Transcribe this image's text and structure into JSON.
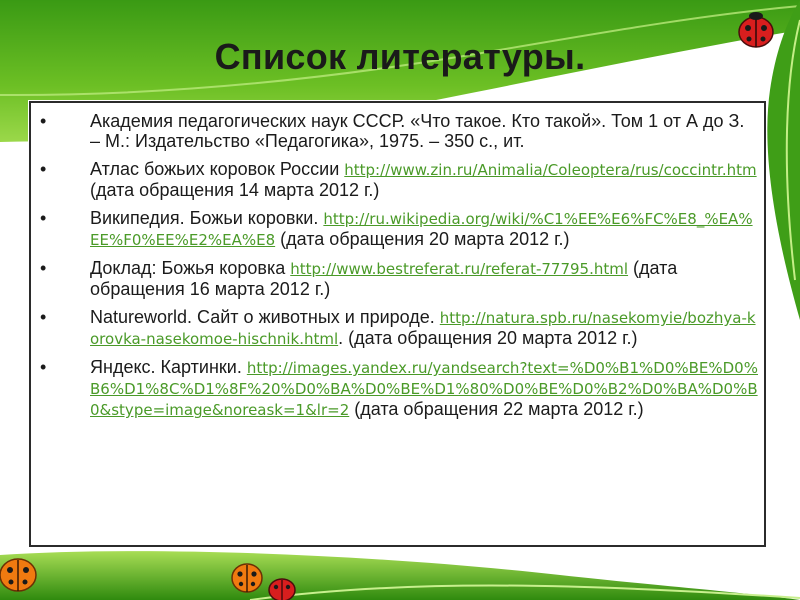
{
  "slide": {
    "title": "Список литературы.",
    "references": [
      {
        "text": "Академия педагогических наук СССР. «Что такое. Кто такой». Том 1 от А до З. – М.: Издательство «Педагогика», 1975. – 350 с., ит.",
        "link": "",
        "after": ""
      },
      {
        "text": "Атлас божьих коровок России ",
        "link": "http://www.zin.ru/Animalia/Coleoptera/rus/coccintr.htm",
        "after": "  (дата обращения 14 марта 2012 г.)"
      },
      {
        "text": "Википедия. Божьи коровки. ",
        "link": "http://ru.wikipedia.org/wiki/%C1%EE%E6%FC%E8_%EA%EE%F0%EE%E2%EA%E8",
        "after": " (дата обращения 20 марта 2012 г.)"
      },
      {
        "text": "Доклад: Божья коровка ",
        "link": "http://www.bestreferat.ru/referat-77795.html",
        "after": " (дата обращения 16 марта 2012 г.)"
      },
      {
        "text": "Natureworld. Сайт о животных и природе. ",
        "link": "http://natura.spb.ru/nasekomyie/bozhya-korovka-nasekomoe-hischnik.html",
        "after": ". (дата обращения 20 марта 2012 г.)"
      },
      {
        "text": "Яндекс. Картинки. ",
        "link": "http://images.yandex.ru/yandsearch?text=%D0%B1%D0%BE%D0%B6%D1%8C%D1%8F%20%D0%BA%D0%BE%D1%80%D0%BE%D0%B2%D0%BA%D0%B0&stype=image&noreask=1&lr=2",
        "after": " (дата обращения 22 марта 2012 г.)"
      }
    ]
  },
  "colors": {
    "leaf_dark": "#2e8b10",
    "leaf_light": "#7cc82a",
    "link": "#4a9a28",
    "ladybug": "#d81e1e",
    "ladybug_orange": "#f07a10"
  },
  "icons": [
    "ladybug-icon",
    "leaf-decoration"
  ]
}
